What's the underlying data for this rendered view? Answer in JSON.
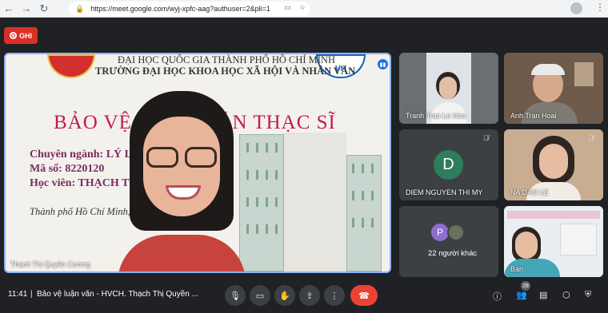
{
  "browser": {
    "url": "https://meet.google.com/wyj-xpfc-aag?authuser=2&pli=1",
    "back_icon": "arrow-left-icon",
    "forward_icon": "arrow-right-icon",
    "reload_icon": "reload-icon"
  },
  "record": {
    "label": "GHI"
  },
  "main_tile": {
    "presenter_name": "Thạch Thị Quyên Cương",
    "slide": {
      "header_line1": "ĐẠI HỌC QUỐC GIA THÀNH PHỐ HỒ CHÍ MINH",
      "header_line2": "TRƯỜNG ĐẠI HỌC KHOA HỌC XÃ HỘI VÀ NHÂN VĂN",
      "title": "BẢO VỆ LUẬN VĂN THẠC SĨ",
      "field": "Chuyên ngành: LÝ L",
      "code": "Mã số: 8220120",
      "student": "Học viên: THẠCH TH",
      "city": "Thành phố Hồ Chí Minh,",
      "logo_right_text": "VH"
    }
  },
  "tiles": [
    {
      "name": "Tranh Tran Le Hoa"
    },
    {
      "name": "Anh Tran Hoai"
    },
    {
      "name": "DIEM NGUYEN THI MY",
      "initial": "D"
    },
    {
      "name": "NA DAO LE"
    },
    {
      "name": "22 người khác",
      "initial": "P"
    },
    {
      "name": "Bạn"
    }
  ],
  "bottom": {
    "time": "11:41",
    "separator": "|",
    "meeting_title": "Bảo vệ luận văn - HVCH. Thạch Thị Quyền ...",
    "participant_count": "28"
  },
  "colors": {
    "record": "#d93025",
    "end_call": "#ea4335",
    "active_border": "#8ab4f8"
  }
}
